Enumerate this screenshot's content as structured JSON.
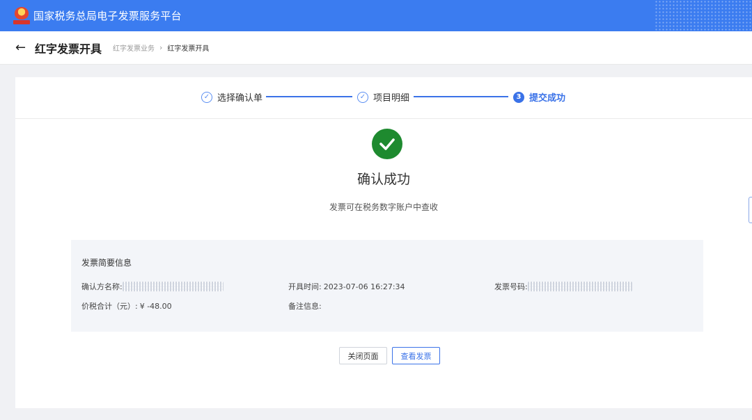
{
  "header": {
    "app_title": "国家税务总局电子发票服务平台",
    "brand_color": "#3b7cf0"
  },
  "title_bar": {
    "back_icon": "←",
    "page_title": "红字发票开具",
    "breadcrumb": {
      "parent": "红字发票业务",
      "separator": "›",
      "current": "红字发票开具"
    }
  },
  "stepper": {
    "steps": [
      {
        "label": "选择确认单",
        "state": "done",
        "marker": "✓"
      },
      {
        "label": "项目明细",
        "state": "done",
        "marker": "✓"
      },
      {
        "label": "提交成功",
        "state": "active",
        "marker": "3"
      }
    ],
    "accent_color": "#3a72e8"
  },
  "result": {
    "icon": "check-circle-icon",
    "icon_color": "#1e8a2f",
    "title": "确认成功",
    "subtitle": "发票可在税务数字账户中查收"
  },
  "invoice_summary": {
    "heading": "发票简要信息",
    "fields": {
      "confirmer_name_label": "确认方名称:",
      "issue_time_label": "开具时间:",
      "issue_time_value": "2023-07-06 16:27:34",
      "invoice_number_label": "发票号码:",
      "total_label": "价税合计（元）:",
      "total_value": "¥ -48.00",
      "remark_label": "备注信息:"
    }
  },
  "actions": {
    "close_label": "关闭页面",
    "view_label": "查看发票"
  }
}
